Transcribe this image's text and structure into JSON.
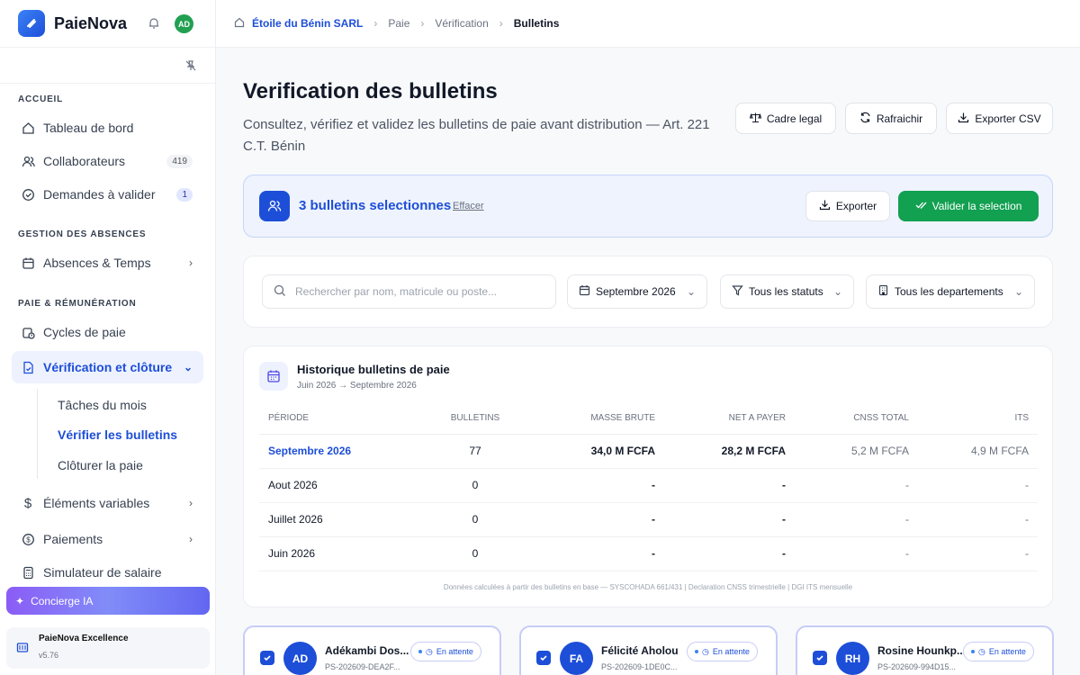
{
  "app": {
    "name": "PaieNova",
    "user_initials": "AD"
  },
  "sidebar": {
    "sections": {
      "accueil": "ACCUEIL",
      "absences": "GESTION DES ABSENCES",
      "paie": "PAIE & RÉMUNÉRATION"
    },
    "items": {
      "dashboard": "Tableau de bord",
      "collaborators": "Collaborateurs",
      "collaborators_count": "419",
      "requests": "Demandes à valider",
      "requests_count": "1",
      "absences": "Absences & Temps",
      "cycles": "Cycles de paie",
      "verification": "Vérification et clôture",
      "sub_tasks": "Tâches du mois",
      "sub_verify": "Vérifier les bulletins",
      "sub_close": "Clôturer la paie",
      "variables": "Éléments variables",
      "payments": "Paiements",
      "simulator": "Simulateur de salaire"
    },
    "concierge": "Concierge IA",
    "plan": {
      "name": "PaieNova Excellence",
      "version": "v5.76"
    }
  },
  "breadcrumb": {
    "company": "Étoile du Bénin SARL",
    "paie": "Paie",
    "verification": "Vérification",
    "current": "Bulletins"
  },
  "page": {
    "title": "Verification des bulletins",
    "subtitle": "Consultez, vérifiez et validez les bulletins de paie avant distribution — Art. 221 C.T. Bénin",
    "actions": {
      "legal": "Cadre legal",
      "refresh": "Rafraichir",
      "export_csv": "Exporter CSV"
    }
  },
  "selection": {
    "text": "3 bulletins selectionnes",
    "clear": "Effacer",
    "export": "Exporter",
    "validate": "Valider la selection"
  },
  "filters": {
    "search_placeholder": "Rechercher par nom, matricule ou poste...",
    "period": "Septembre 2026",
    "status": "Tous les statuts",
    "department": "Tous les departements"
  },
  "history": {
    "title": "Historique bulletins de paie",
    "range": "Juin 2026 → Septembre 2026",
    "columns": [
      "PÉRIODE",
      "BULLETINS",
      "MASSE BRUTE",
      "NET A PAYER",
      "CNSS TOTAL",
      "ITS"
    ],
    "rows": [
      [
        "Septembre 2026",
        "77",
        "34,0 M FCFA",
        "28,2 M FCFA",
        "5,2 M FCFA",
        "4,9 M FCFA"
      ],
      [
        "Aout 2026",
        "0",
        "-",
        "-",
        "-",
        "-"
      ],
      [
        "Juillet 2026",
        "0",
        "-",
        "-",
        "-",
        "-"
      ],
      [
        "Juin 2026",
        "0",
        "-",
        "-",
        "-",
        "-"
      ]
    ],
    "note": "Données calculées à partir des bulletins en base — SYSCOHADA 661/431 | Declaration CNSS trimestrielle | DGI ITS mensuelle"
  },
  "cards": [
    {
      "initials": "AD",
      "name": "Adékambi Dos...",
      "id": "PS-202609-DEA2F...",
      "status": "En attente"
    },
    {
      "initials": "FA",
      "name": "Félicité Aholou",
      "id": "PS-202609-1DE0C...",
      "status": "En attente"
    },
    {
      "initials": "RH",
      "name": "Rosine Hounkp...",
      "id": "PS-202609-994D15...",
      "status": "En attente"
    }
  ]
}
